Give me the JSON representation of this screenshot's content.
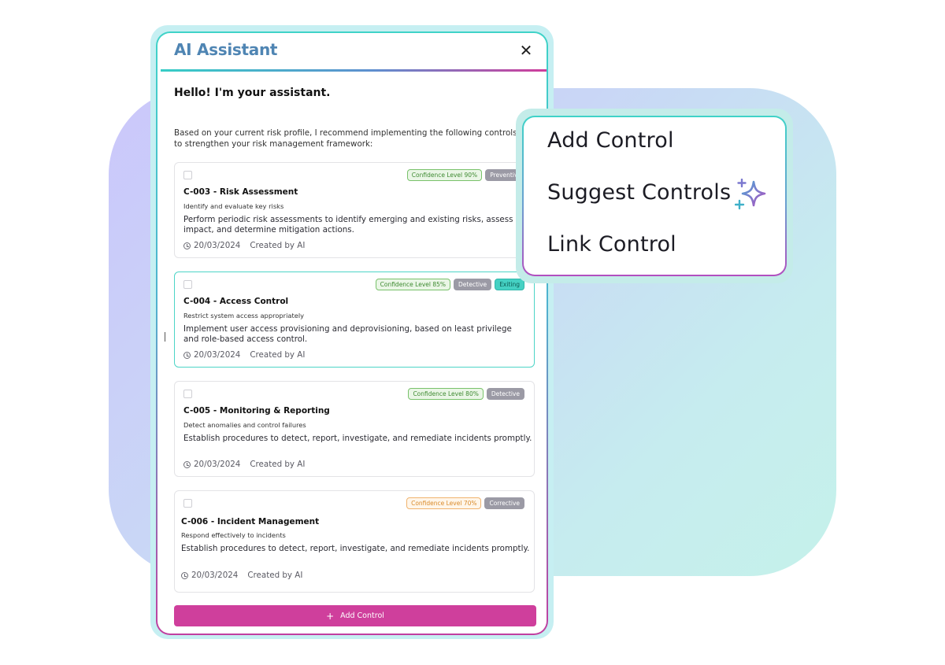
{
  "panel": {
    "title": "AI Assistant",
    "close_glyph": "✕",
    "greeting": "Hello! I'm your assistant.",
    "intro": "Based on your current risk profile, I recommend implementing the following controls to strengthen your risk management framework:"
  },
  "cards": [
    {
      "confidence": "Confidence Level 90%",
      "type": "Preventive",
      "title": "C-003 - Risk Assessment",
      "subtitle": "Identify and evaluate key risks",
      "description": "Perform periodic risk assessments to identify emerging and existing risks, assess impact, and determine mitigation actions.",
      "date": "20/03/2024",
      "creator": "Created by AI"
    },
    {
      "confidence": "Confidence Level 85%",
      "type": "Detective",
      "status": "Exiting",
      "title": "C-004 - Access Control",
      "subtitle": "Restrict system access appropriately",
      "description": "Implement user access provisioning and deprovisioning, based on least privilege and role-based access control.",
      "date": "20/03/2024",
      "creator": "Created by AI"
    },
    {
      "confidence": "Confidence Level 80%",
      "type": "Detective",
      "title": "C-005 - Monitoring & Reporting",
      "subtitle": "Detect anomalies and control failures",
      "description": "Establish procedures to detect, report, investigate, and remediate incidents promptly.",
      "date": "20/03/2024",
      "creator": "Created by AI"
    },
    {
      "confidence": "Confidence Level 70%",
      "type": "Corrective",
      "title": "C-006 - Incident Management",
      "subtitle": "Respond effectively to incidents",
      "description": "Establish procedures to detect, report, investigate, and remediate incidents promptly.",
      "date": "20/03/2024",
      "creator": "Created by AI"
    }
  ],
  "add_button": {
    "icon": "+",
    "label": "Add Control"
  },
  "menu": {
    "items": [
      "Add Control",
      "Suggest Controls",
      "Link Control"
    ],
    "sparkle_icon": "sparkle-icon"
  },
  "colors": {
    "accent": "#cf3f9c",
    "teal": "#45d1c3",
    "title": "#4f85b3"
  }
}
